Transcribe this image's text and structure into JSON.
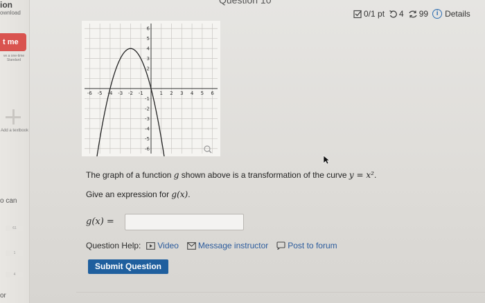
{
  "sidebar": {
    "title": "ion",
    "subtitle": "ownload",
    "button_label": "t me",
    "tiny_text": "ve a one-time Standard",
    "add_textbook": "Add a textbook",
    "can_text": "o can",
    "rows": [
      "61",
      "1",
      "4"
    ],
    "bottom_text": "or"
  },
  "header": {
    "question_title": "Question 10",
    "score": "0/1 pt",
    "retries": "4",
    "attempts": "99",
    "details_label": "Details"
  },
  "graph": {
    "x_ticks": [
      "-6",
      "-5",
      "-4",
      "-3",
      "-2",
      "-1",
      "1",
      "2",
      "3",
      "4",
      "5",
      "6"
    ],
    "y_ticks": [
      "6",
      "5",
      "4",
      "3",
      "2",
      "-1",
      "-2",
      "-3",
      "-4",
      "-5",
      "-6"
    ],
    "xlim": [
      -6.5,
      6.5
    ],
    "ylim": [
      -6.5,
      6.5
    ],
    "curve": {
      "vertex": [
        -2,
        4
      ],
      "a": -1
    },
    "grid": true
  },
  "question": {
    "text_before": "The graph of a function ",
    "var_g": "g",
    "text_middle": " shown above is a transformation of the curve ",
    "curve_eq": "y = x²",
    "text_end": ".",
    "give_text": "Give an expression for ",
    "give_expr": "g(x)",
    "give_end": ".",
    "answer_label": "g(x) =",
    "answer_value": ""
  },
  "help": {
    "label": "Question Help:",
    "video": "Video",
    "message": "Message instructor",
    "forum": "Post to forum"
  },
  "submit_label": "Submit Question",
  "colors": {
    "accent": "#1f5f9e",
    "link": "#2a5a9c",
    "sidebar_button": "#d9534f"
  }
}
